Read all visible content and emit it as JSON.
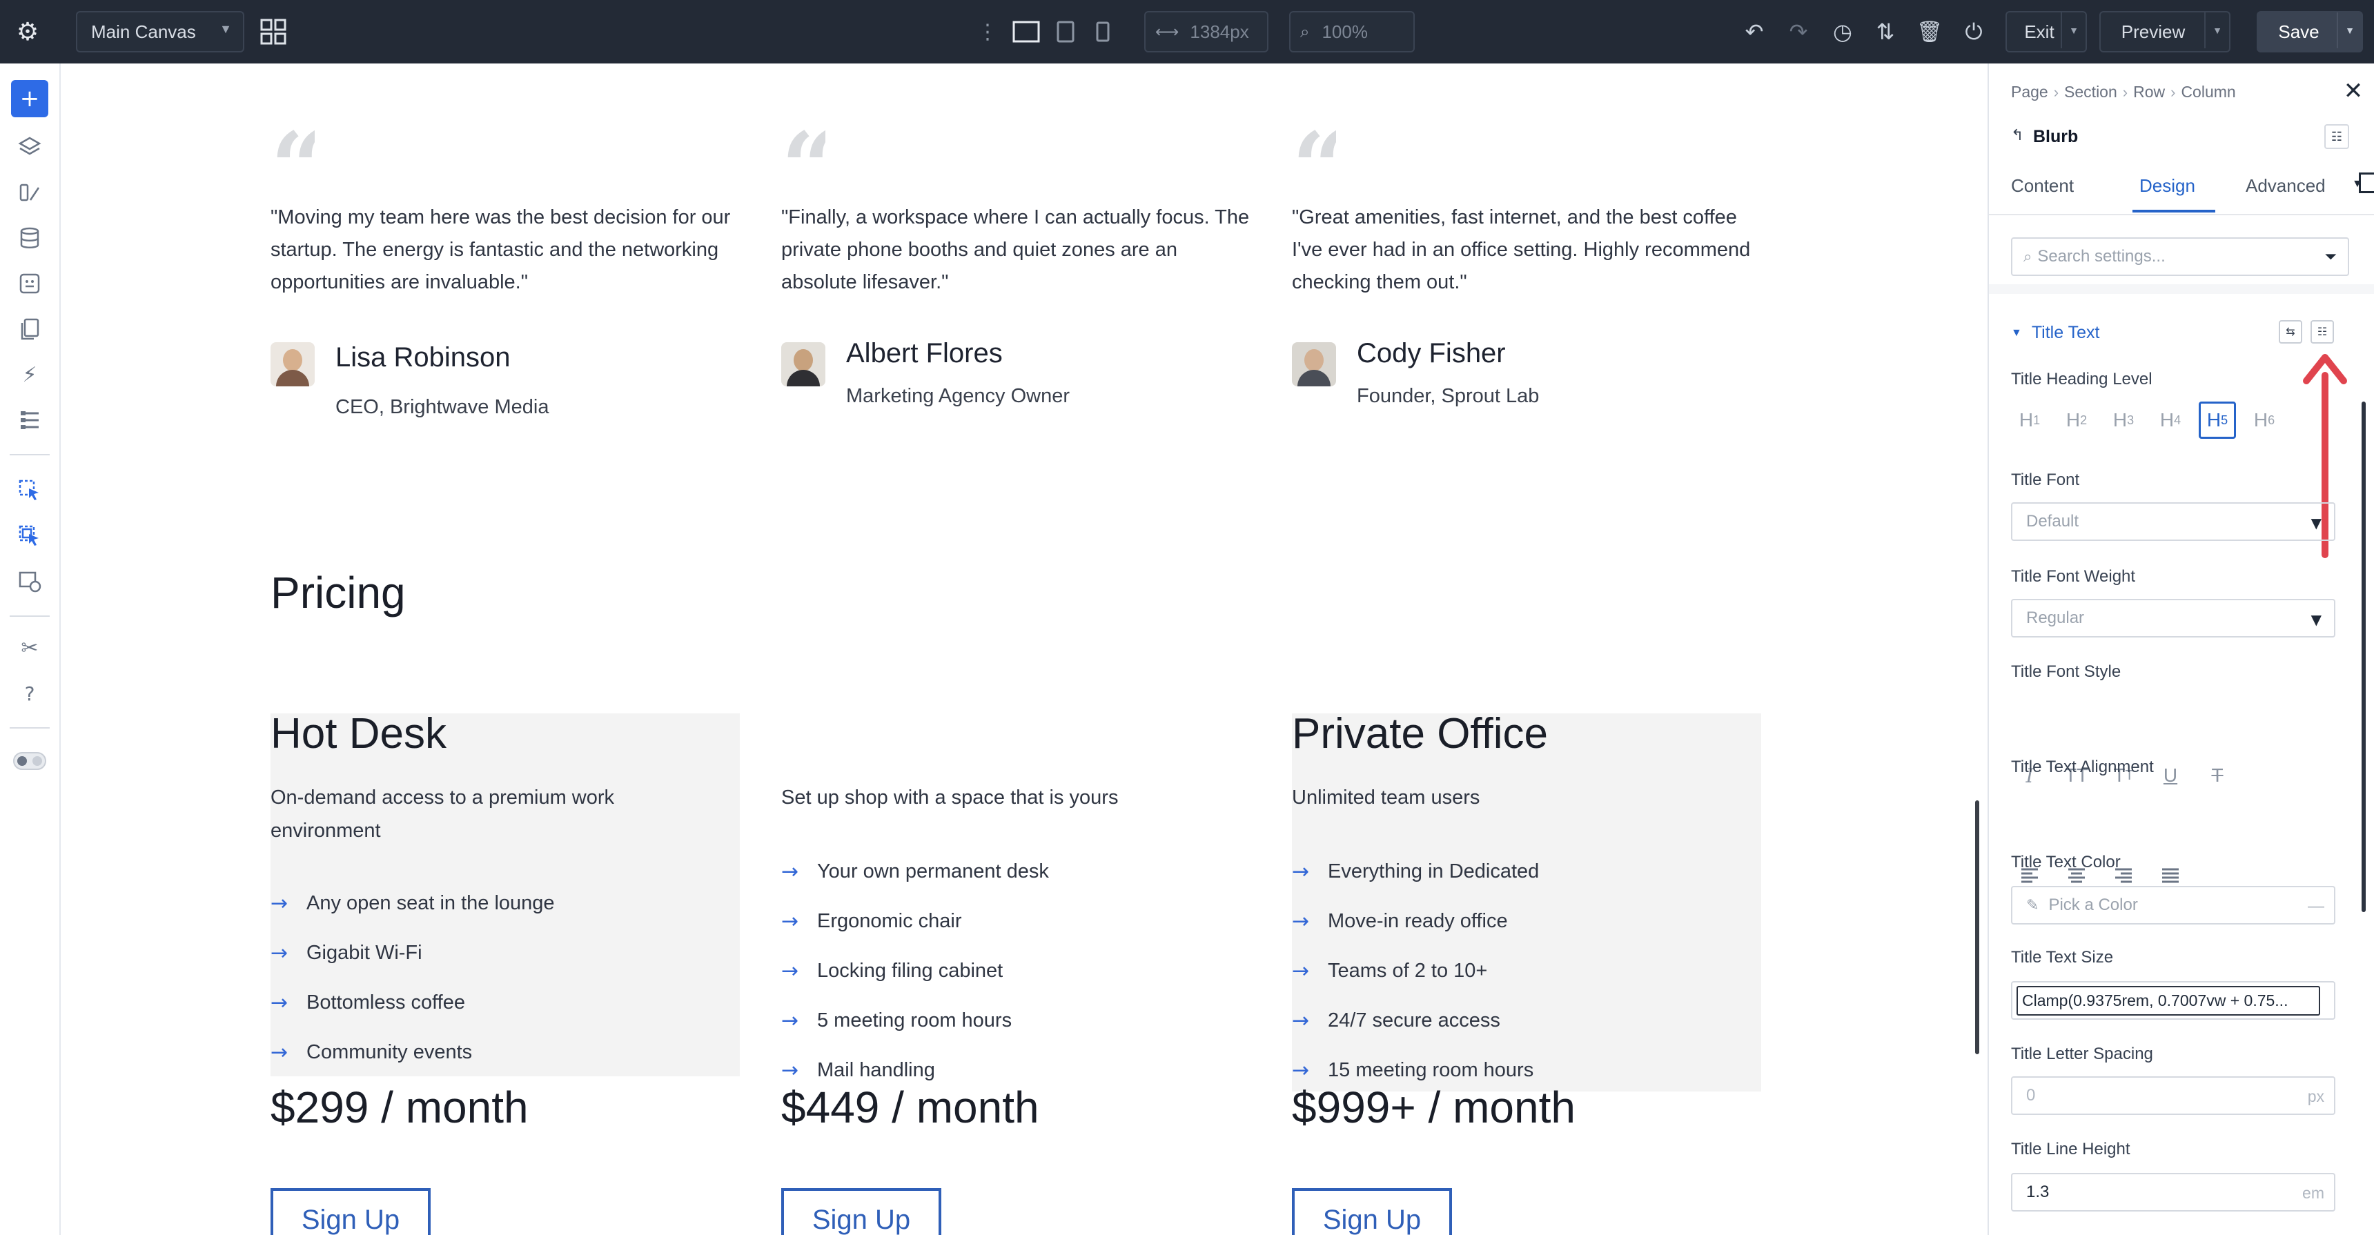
{
  "topbar": {
    "canvas_select": "Main Canvas",
    "width_value": "1384px",
    "zoom_value": "100%",
    "exit_label": "Exit",
    "preview_label": "Preview",
    "save_label": "Save"
  },
  "testimonials": [
    {
      "quote": "\"Moving my team here was the best decision for our startup. The energy is fantastic and the networking opportunities are invaluable.\"",
      "name": "Lisa Robinson",
      "role": "CEO, Brightwave Media"
    },
    {
      "quote": "\"Finally, a workspace where I can actually focus. The private phone booths and quiet zones are an absolute lifesaver.\"",
      "name": "Albert Flores",
      "role": "Marketing Agency Owner"
    },
    {
      "quote": "\"Great amenities, fast internet, and the best coffee I've ever had in an office setting. Highly recommend checking them out.\"",
      "name": "Cody Fisher",
      "role": "Founder, Sprout Lab"
    }
  ],
  "pricing": {
    "title": "Pricing",
    "plans": [
      {
        "title": "Hot Desk",
        "desc": "On-demand access to a premium work environment",
        "features": [
          "Any open seat in the lounge",
          "Gigabit Wi-Fi",
          "Bottomless coffee",
          "Community events"
        ],
        "price": "$299 / month",
        "cta": "Sign Up"
      },
      {
        "title": "",
        "desc": "Set up shop with a space that is yours",
        "features": [
          "Your own permanent desk",
          "Ergonomic chair",
          "Locking filing cabinet",
          "5 meeting room hours",
          "Mail handling"
        ],
        "price": "$449 / month",
        "cta": "Sign Up"
      },
      {
        "title": "Private Office",
        "desc": "Unlimited team users",
        "features": [
          "Everything in Dedicated",
          "Move-in ready office",
          "Teams of 2 to 10+",
          "24/7 secure access",
          "15 meeting room hours"
        ],
        "price": "$999+ / month",
        "cta": "Sign Up"
      }
    ]
  },
  "panel": {
    "breadcrumb": [
      "Page",
      "Section",
      "Row",
      "Column"
    ],
    "module_name": "Blurb",
    "tabs": [
      "Content",
      "Design",
      "Advanced"
    ],
    "search_placeholder": "Search settings...",
    "group_title": "Title Text",
    "labels": {
      "heading_level": "Title Heading Level",
      "font": "Title Font",
      "font_weight": "Title Font Weight",
      "font_style": "Title Font Style",
      "alignment": "Title Text Alignment",
      "color": "Title Text Color",
      "size": "Title Text Size",
      "letter_spacing": "Title Letter Spacing",
      "line_height": "Title Line Height"
    },
    "heading_levels": [
      "H1",
      "H2",
      "H3",
      "H4",
      "H5",
      "H6"
    ],
    "active_heading": "H5",
    "font_value": "Default",
    "weight_value": "Regular",
    "color_placeholder": "Pick a Color",
    "size_value": "Clamp(0.9375rem, 0.7007vw + 0.75...",
    "letter_spacing_value": "0",
    "letter_spacing_unit": "px",
    "line_height_value": "1.3",
    "line_height_unit": "em"
  },
  "colors": {
    "topbar_bg": "#232a36",
    "accent": "#2563c9",
    "annotation_arrow": "#e0444e",
    "plan_bg": "#f3f3f3"
  }
}
